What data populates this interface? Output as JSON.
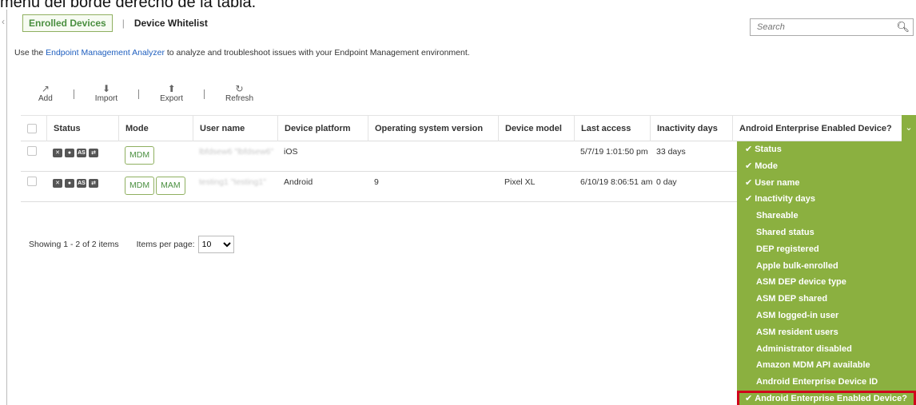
{
  "caption": "menú del borde derecho de la tabla.",
  "tabs": {
    "active": "Enrolled Devices",
    "separator": "|",
    "other": "Device Whitelist"
  },
  "search": {
    "placeholder": "Search"
  },
  "info": {
    "prefix": "Use the ",
    "link": "Endpoint Management Analyzer",
    "suffix": " to analyze and troubleshoot issues with your Endpoint Management environment."
  },
  "toolbar": {
    "add": "Add",
    "import": "Import",
    "export": "Export",
    "refresh": "Refresh"
  },
  "table": {
    "headers": {
      "status": "Status",
      "mode": "Mode",
      "username": "User name",
      "platform": "Device platform",
      "osversion": "Operating system version",
      "model": "Device model",
      "lastaccess": "Last access",
      "inactivity": "Inactivity days",
      "android": "Android Enterprise Enabled Device?"
    },
    "rows": [
      {
        "mode1": "MDM",
        "username": "lbfdsew6 \"lbfdsew6\"",
        "platform": "iOS",
        "osversion": "",
        "model": "",
        "lastaccess": "5/7/19 1:01:50 pm",
        "inactivity": "33 days"
      },
      {
        "mode1": "MDM",
        "mode2": "MAM",
        "username": "testing1 \"testing1\"",
        "platform": "Android",
        "osversion": "9",
        "model": "Pixel XL",
        "lastaccess": "6/10/19 8:06:51 am",
        "inactivity": "0 day"
      }
    ],
    "status_icon_labels": [
      "AS"
    ]
  },
  "pager": {
    "showing": "Showing 1 - 2 of 2 items",
    "items_per_page": "Items per page:",
    "page_size": "10"
  },
  "column_menu": {
    "items": [
      {
        "label": "Status",
        "checked": true
      },
      {
        "label": "Mode",
        "checked": true
      },
      {
        "label": "User name",
        "checked": true
      },
      {
        "label": "Inactivity days",
        "checked": true
      },
      {
        "label": "Shareable",
        "checked": false
      },
      {
        "label": "Shared status",
        "checked": false
      },
      {
        "label": "DEP registered",
        "checked": false
      },
      {
        "label": "Apple bulk-enrolled",
        "checked": false
      },
      {
        "label": "ASM DEP device type",
        "checked": false
      },
      {
        "label": "ASM DEP shared",
        "checked": false
      },
      {
        "label": "ASM logged-in user",
        "checked": false
      },
      {
        "label": "ASM resident users",
        "checked": false
      },
      {
        "label": "Administrator disabled",
        "checked": false
      },
      {
        "label": "Amazon MDM API available",
        "checked": false
      },
      {
        "label": "Android Enterprise Device ID",
        "checked": false
      },
      {
        "label": "Android Enterprise Enabled Device?",
        "checked": true
      }
    ]
  },
  "colors": {
    "accent_green": "#8bb040",
    "link_blue": "#1f5fbf",
    "highlight_red": "#d0021b"
  }
}
